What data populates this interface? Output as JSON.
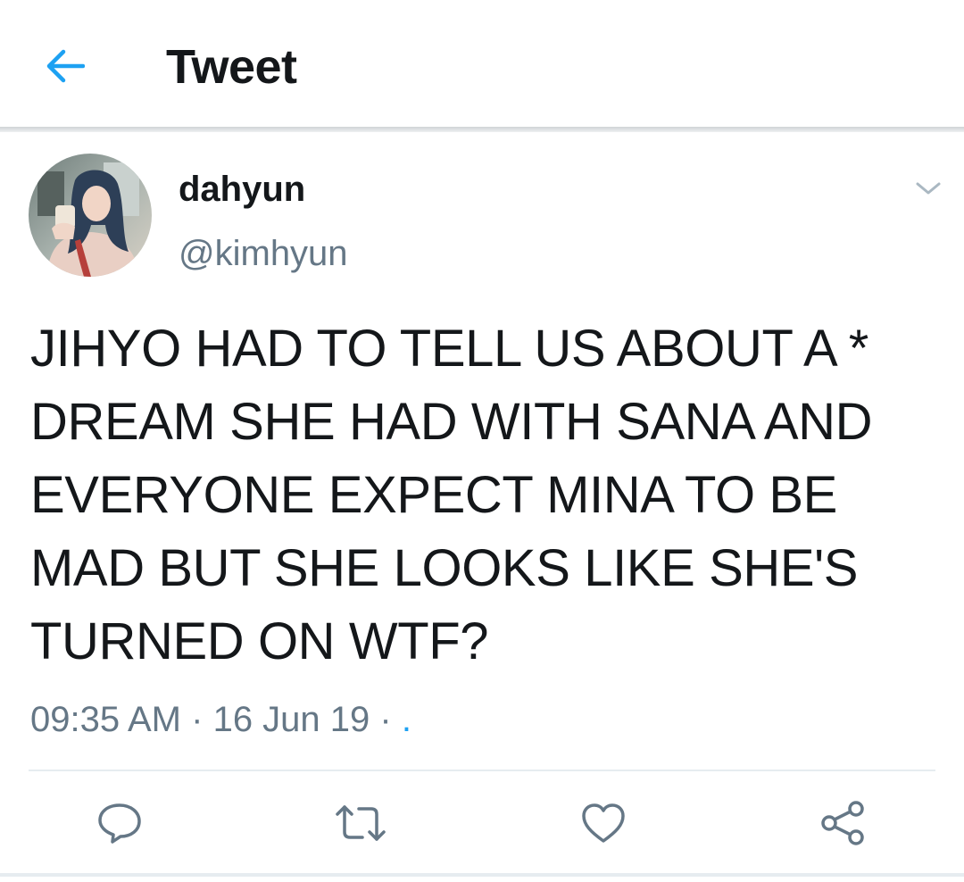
{
  "header": {
    "title": "Tweet",
    "back_icon": "arrow-left-icon",
    "accent_color": "#1da1f2"
  },
  "tweet": {
    "display_name": "dahyun",
    "handle": "@kimhyun",
    "text": "JIHYO HAD TO TELL US ABOUT A * DREAM SHE HAD WITH SANA AND EVERYONE EXPECT MINA TO BE MAD BUT SHE LOOKS LIKE SHE'S TURNED ON WTF?",
    "time": "09:35 AM",
    "date": "16 Jun 19",
    "source_dot": "."
  },
  "actions": {
    "reply_icon": "reply-icon",
    "retweet_icon": "retweet-icon",
    "like_icon": "heart-icon",
    "share_icon": "share-icon"
  },
  "colors": {
    "text": "#14171a",
    "secondary": "#657786",
    "icon": "#657786",
    "divider": "#e6ecf0"
  }
}
